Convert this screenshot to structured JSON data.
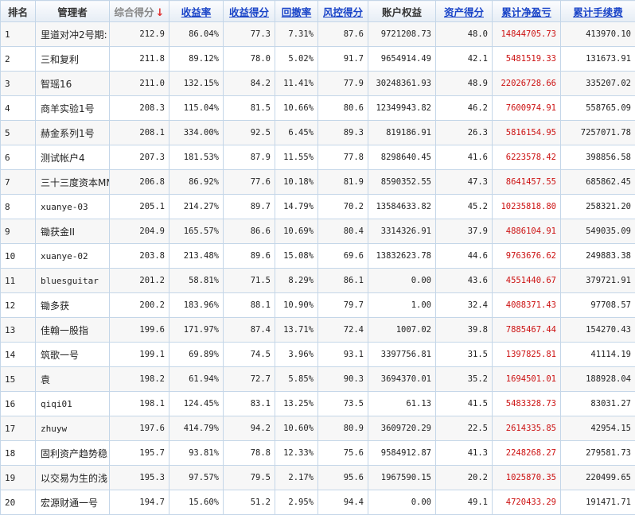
{
  "colors": {
    "profit": "#cc1111",
    "link": "#1a44c8",
    "sort_arrow": "#e03030"
  },
  "headers": [
    {
      "key": "rank",
      "label": "排名",
      "style": "plain"
    },
    {
      "key": "manager",
      "label": "管理者",
      "style": "plain"
    },
    {
      "key": "score",
      "label": "综合得分",
      "style": "sorted",
      "sort_icon": "arrow-down-icon",
      "sort_glyph": "↓"
    },
    {
      "key": "return_rate",
      "label": "收益率",
      "style": "sortable"
    },
    {
      "key": "return_score",
      "label": "收益得分",
      "style": "sortable"
    },
    {
      "key": "drawdown",
      "label": "回撤率",
      "style": "sortable"
    },
    {
      "key": "risk_score",
      "label": "风控得分",
      "style": "sortable"
    },
    {
      "key": "equity",
      "label": "账户权益",
      "style": "plain"
    },
    {
      "key": "asset_score",
      "label": "资产得分",
      "style": "sortable"
    },
    {
      "key": "net_pnl",
      "label": "累计净盈亏",
      "style": "sortable"
    },
    {
      "key": "fees",
      "label": "累计手续费",
      "style": "sortable"
    }
  ],
  "rows": [
    {
      "rank": "1",
      "manager": "里道对冲2号期:",
      "score": "212.9",
      "return_rate": "86.04%",
      "return_score": "77.3",
      "drawdown": "7.31%",
      "risk_score": "87.6",
      "equity": "9721208.73",
      "asset_score": "48.0",
      "net_pnl": "14844705.73",
      "fees": "413970.10"
    },
    {
      "rank": "2",
      "manager": "三和复利",
      "score": "211.8",
      "return_rate": "89.12%",
      "return_score": "78.0",
      "drawdown": "5.02%",
      "risk_score": "91.7",
      "equity": "9654914.49",
      "asset_score": "42.1",
      "net_pnl": "5481519.33",
      "fees": "131673.91"
    },
    {
      "rank": "3",
      "manager": "智瑶16",
      "score": "211.0",
      "return_rate": "132.15%",
      "return_score": "84.2",
      "drawdown": "11.41%",
      "risk_score": "77.9",
      "equity": "30248361.93",
      "asset_score": "48.9",
      "net_pnl": "22026728.66",
      "fees": "335207.02"
    },
    {
      "rank": "4",
      "manager": "商羊实验1号",
      "score": "208.3",
      "return_rate": "115.04%",
      "return_score": "81.5",
      "drawdown": "10.66%",
      "risk_score": "80.6",
      "equity": "12349943.82",
      "asset_score": "46.2",
      "net_pnl": "7600974.91",
      "fees": "558765.09"
    },
    {
      "rank": "5",
      "manager": "赫金系列1号",
      "score": "208.1",
      "return_rate": "334.00%",
      "return_score": "92.5",
      "drawdown": "6.45%",
      "risk_score": "89.3",
      "equity": "819186.91",
      "asset_score": "26.3",
      "net_pnl": "5816154.95",
      "fees": "7257071.78"
    },
    {
      "rank": "6",
      "manager": "测试帐户4",
      "score": "207.3",
      "return_rate": "181.53%",
      "return_score": "87.9",
      "drawdown": "11.55%",
      "risk_score": "77.8",
      "equity": "8298640.45",
      "asset_score": "41.6",
      "net_pnl": "6223578.42",
      "fees": "398856.58"
    },
    {
      "rank": "7",
      "manager": "三十三度资本MM",
      "score": "206.8",
      "return_rate": "86.92%",
      "return_score": "77.6",
      "drawdown": "10.18%",
      "risk_score": "81.9",
      "equity": "8590352.55",
      "asset_score": "47.3",
      "net_pnl": "8641457.55",
      "fees": "685862.45"
    },
    {
      "rank": "8",
      "manager": "xuanye-03",
      "score": "205.1",
      "return_rate": "214.27%",
      "return_score": "89.7",
      "drawdown": "14.79%",
      "risk_score": "70.2",
      "equity": "13584633.82",
      "asset_score": "45.2",
      "net_pnl": "10235818.80",
      "fees": "258321.20"
    },
    {
      "rank": "9",
      "manager": "锄获金II",
      "score": "204.9",
      "return_rate": "165.57%",
      "return_score": "86.6",
      "drawdown": "10.69%",
      "risk_score": "80.4",
      "equity": "3314326.91",
      "asset_score": "37.9",
      "net_pnl": "4886104.91",
      "fees": "549035.09"
    },
    {
      "rank": "10",
      "manager": "xuanye-02",
      "score": "203.8",
      "return_rate": "213.48%",
      "return_score": "89.6",
      "drawdown": "15.08%",
      "risk_score": "69.6",
      "equity": "13832623.78",
      "asset_score": "44.6",
      "net_pnl": "9763676.62",
      "fees": "249883.38"
    },
    {
      "rank": "11",
      "manager": "bluesguitar",
      "score": "201.2",
      "return_rate": "58.81%",
      "return_score": "71.5",
      "drawdown": "8.29%",
      "risk_score": "86.1",
      "equity": "0.00",
      "asset_score": "43.6",
      "net_pnl": "4551440.67",
      "fees": "379721.91"
    },
    {
      "rank": "12",
      "manager": "锄多获",
      "score": "200.2",
      "return_rate": "183.96%",
      "return_score": "88.1",
      "drawdown": "10.90%",
      "risk_score": "79.7",
      "equity": "1.00",
      "asset_score": "32.4",
      "net_pnl": "4088371.43",
      "fees": "97708.57"
    },
    {
      "rank": "13",
      "manager": "佳翰一股指",
      "score": "199.6",
      "return_rate": "171.97%",
      "return_score": "87.4",
      "drawdown": "13.71%",
      "risk_score": "72.4",
      "equity": "1007.02",
      "asset_score": "39.8",
      "net_pnl": "7885467.44",
      "fees": "154270.43"
    },
    {
      "rank": "14",
      "manager": "筑歌一号",
      "score": "199.1",
      "return_rate": "69.89%",
      "return_score": "74.5",
      "drawdown": "3.96%",
      "risk_score": "93.1",
      "equity": "3397756.81",
      "asset_score": "31.5",
      "net_pnl": "1397825.81",
      "fees": "41114.19"
    },
    {
      "rank": "15",
      "manager": "袁",
      "score": "198.2",
      "return_rate": "61.94%",
      "return_score": "72.7",
      "drawdown": "5.85%",
      "risk_score": "90.3",
      "equity": "3694370.01",
      "asset_score": "35.2",
      "net_pnl": "1694501.01",
      "fees": "188928.04"
    },
    {
      "rank": "16",
      "manager": "qiqi01",
      "score": "198.1",
      "return_rate": "124.45%",
      "return_score": "83.1",
      "drawdown": "13.25%",
      "risk_score": "73.5",
      "equity": "61.13",
      "asset_score": "41.5",
      "net_pnl": "5483328.73",
      "fees": "83031.27"
    },
    {
      "rank": "17",
      "manager": "zhuyw",
      "score": "197.6",
      "return_rate": "414.79%",
      "return_score": "94.2",
      "drawdown": "10.60%",
      "risk_score": "80.9",
      "equity": "3609720.29",
      "asset_score": "22.5",
      "net_pnl": "2614335.85",
      "fees": "42954.15"
    },
    {
      "rank": "18",
      "manager": "固利资产趋势稳",
      "score": "195.7",
      "return_rate": "93.81%",
      "return_score": "78.8",
      "drawdown": "12.33%",
      "risk_score": "75.6",
      "equity": "9584912.87",
      "asset_score": "41.3",
      "net_pnl": "2248268.27",
      "fees": "279581.73"
    },
    {
      "rank": "19",
      "manager": "以交易为生的浅",
      "score": "195.3",
      "return_rate": "97.57%",
      "return_score": "79.5",
      "drawdown": "2.17%",
      "risk_score": "95.6",
      "equity": "1967590.15",
      "asset_score": "20.2",
      "net_pnl": "1025870.35",
      "fees": "220499.65"
    },
    {
      "rank": "20",
      "manager": "宏源财通一号",
      "score": "194.7",
      "return_rate": "15.60%",
      "return_score": "51.2",
      "drawdown": "2.95%",
      "risk_score": "94.4",
      "equity": "0.00",
      "asset_score": "49.1",
      "net_pnl": "4720433.29",
      "fees": "191471.71"
    }
  ]
}
